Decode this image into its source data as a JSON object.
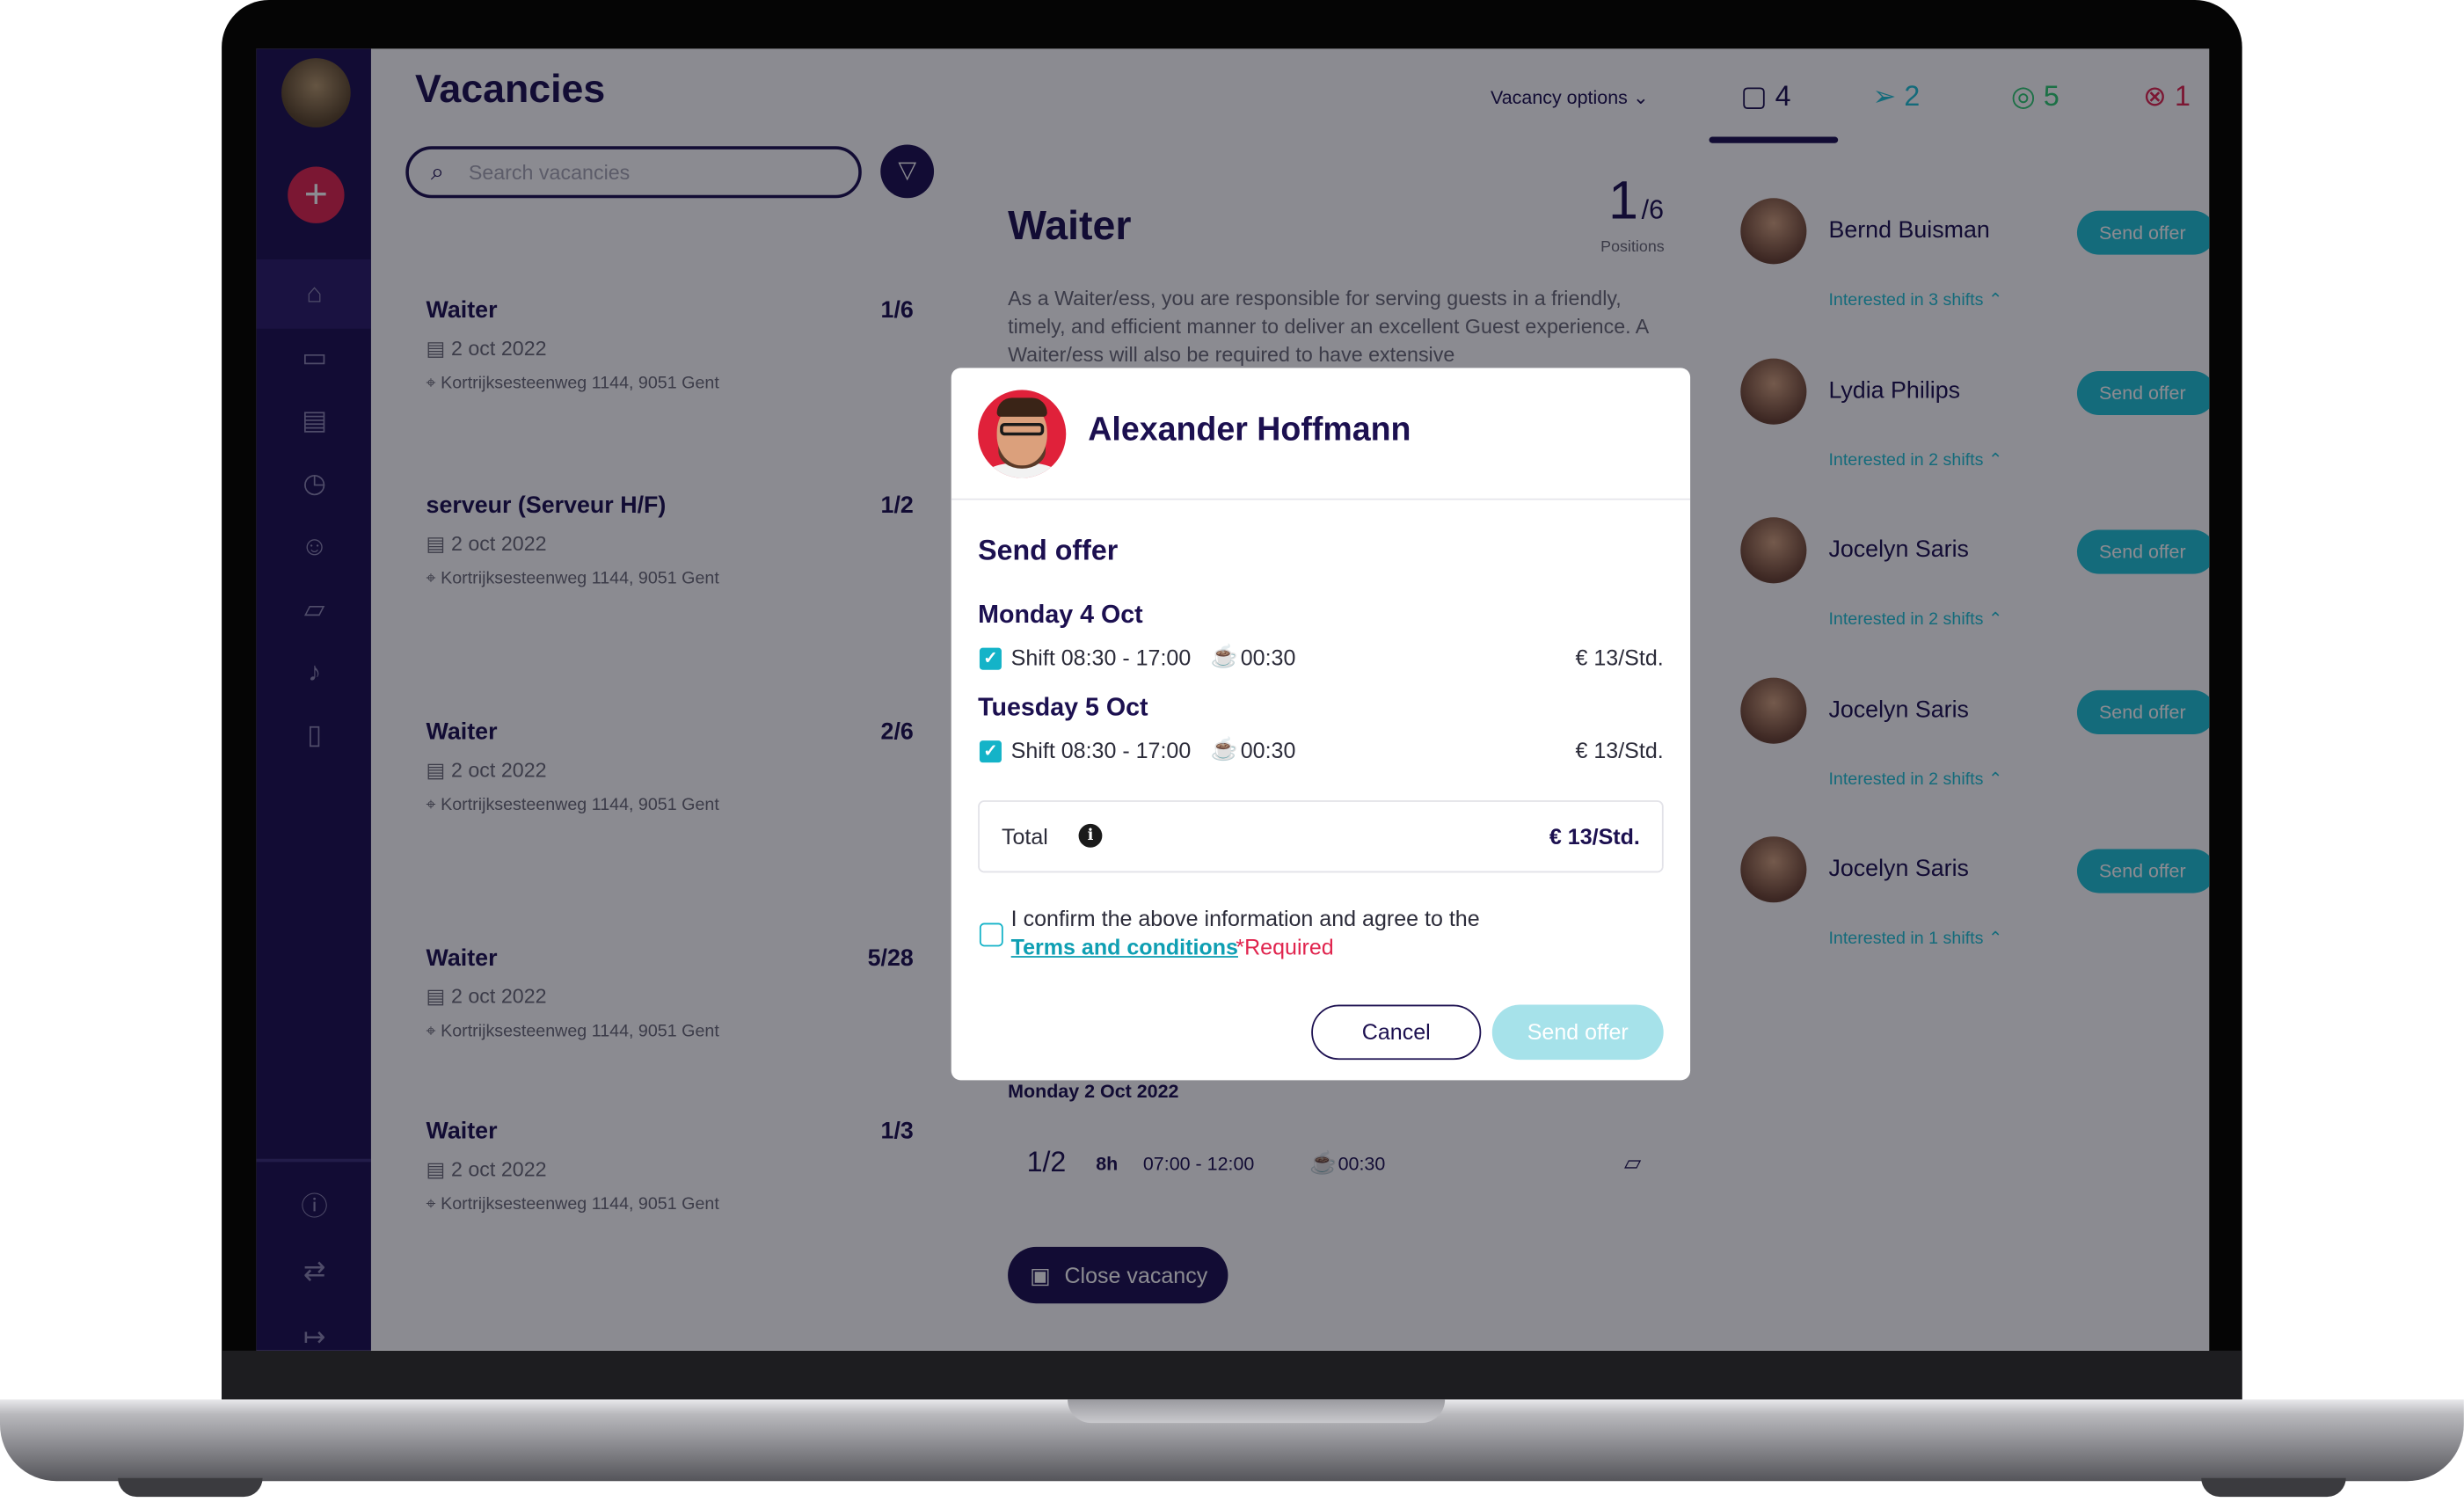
{
  "sidebar": {
    "add_label": "+",
    "icons": [
      "home-icon",
      "briefcase-icon",
      "calendar-icon",
      "timer-icon",
      "users-icon",
      "chat-icon",
      "bell-icon",
      "document-icon",
      "info-icon",
      "swap-icon",
      "logout-icon"
    ]
  },
  "vacancies": {
    "title": "Vacancies",
    "search_placeholder": "Search vacancies",
    "items": [
      {
        "title": "Waiter",
        "count": "1/6",
        "date": "2 oct 2022",
        "address": "Kortrijksesteenweg 1144, 9051 Gent"
      },
      {
        "title": "serveur (Serveur H/F)",
        "count": "1/2",
        "date": "2 oct 2022",
        "address": "Kortrijksesteenweg 1144, 9051 Gent"
      },
      {
        "title": "Waiter",
        "count": "2/6",
        "date": "2 oct 2022",
        "address": "Kortrijksesteenweg 1144, 9051 Gent"
      },
      {
        "title": "Waiter",
        "count": "5/28",
        "date": "2 oct 2022",
        "address": "Kortrijksesteenweg 1144, 9051 Gent"
      },
      {
        "title": "Waiter",
        "count": "1/3",
        "date": "2 oct 2022",
        "address": "Kortrijksesteenweg 1144, 9051 Gent"
      }
    ]
  },
  "detail": {
    "options_label": "Vacancy options",
    "title": "Waiter",
    "positions_filled": "1",
    "positions_total": "/6",
    "positions_label": "Positions",
    "description": "As a Waiter/ess, you are responsible for serving guests in a friendly, timely, and efficient manner to deliver an excellent Guest experience. A Waiter/ess will also be required to have extensive",
    "date_heading": "Monday 2 Oct 2022",
    "shift_count": "1/2",
    "shift_hours": "8h",
    "shift_time": "07:00 - 12:00",
    "shift_break": "00:30",
    "close_label": "Close vacancy"
  },
  "tabs": [
    {
      "count": "4",
      "color": "#1c1050"
    },
    {
      "count": "2",
      "color": "#1fc3d6"
    },
    {
      "count": "5",
      "color": "#2ecc71"
    },
    {
      "count": "1",
      "color": "#e0244e"
    }
  ],
  "candidates": [
    {
      "name": "Bernd Buisman",
      "action": "Send offer",
      "interest": "Interested in 3 shifts"
    },
    {
      "name": "Lydia Philips",
      "action": "Send offer",
      "interest": "Interested in 2 shifts"
    },
    {
      "name": "Jocelyn Saris",
      "action": "Send offer",
      "interest": "Interested in 2 shifts"
    },
    {
      "name": "Jocelyn Saris",
      "action": "Send offer",
      "interest": "Interested in 2 shifts"
    },
    {
      "name": "Jocelyn Saris",
      "action": "Send offer",
      "interest": "Interested in 1 shifts"
    }
  ],
  "modal": {
    "name": "Alexander Hoffmann",
    "title": "Send offer",
    "days": [
      {
        "day": "Monday 4 Oct",
        "shift": "Shift 08:30 - 17:00",
        "break": "00:30",
        "rate": "€ 13/Std."
      },
      {
        "day": "Tuesday 5 Oct",
        "shift": "Shift 08:30 - 17:00",
        "break": "00:30",
        "rate": "€ 13/Std."
      }
    ],
    "total_label": "Total",
    "total_value": "€ 13/Std.",
    "agree_text": "I confirm the above information and agree to the",
    "terms_label": "Terms and conditions",
    "required_label": "*Required",
    "cancel_label": "Cancel",
    "send_label": "Send offer"
  }
}
